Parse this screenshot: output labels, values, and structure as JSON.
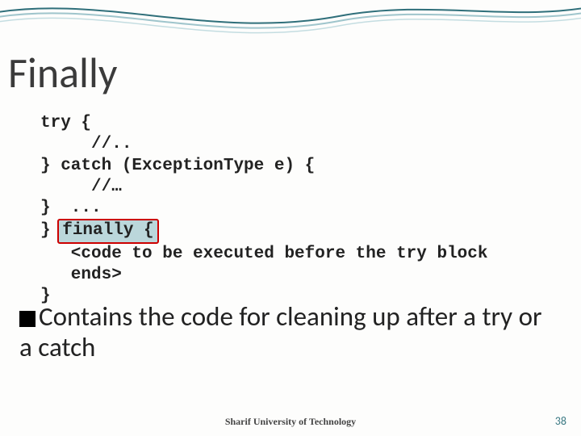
{
  "title": "Finally",
  "code": {
    "l1": "try {",
    "l2": "     //..",
    "l3": "} catch (ExceptionType e) {",
    "l4": "     //…",
    "l5": "}  ...",
    "l6_prefix": "} ",
    "l6_highlight": "finally {",
    "l7": "   <code to be executed before the try block",
    "l8": "   ends>",
    "l9": "}"
  },
  "bullet": "Contains the code for cleaning up after a try or a catch",
  "footer": "Sharif University of Technology",
  "page": "38"
}
